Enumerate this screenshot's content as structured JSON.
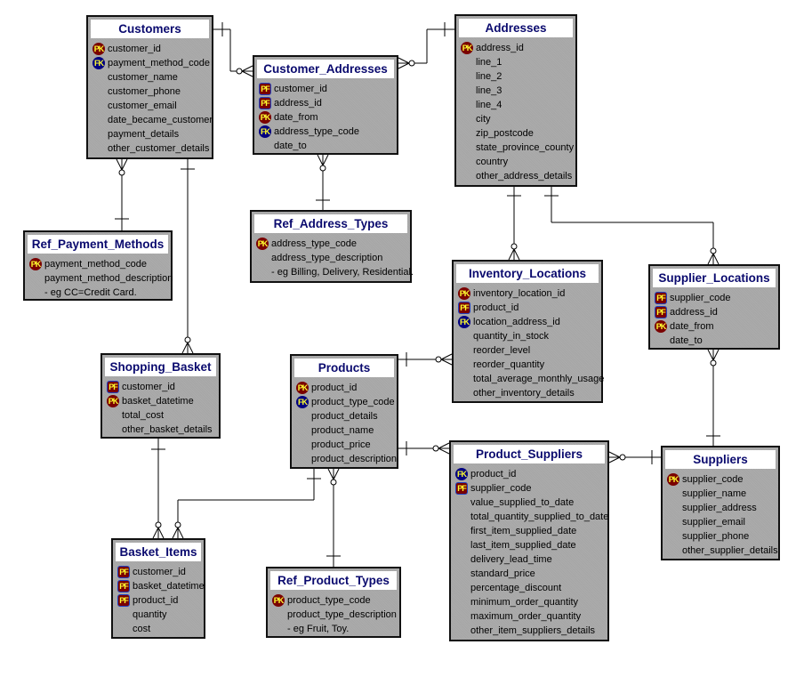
{
  "entities": {
    "customers": {
      "name": "Customers",
      "columns": [
        {
          "key": "PK",
          "name": "customer_id"
        },
        {
          "key": "FK",
          "name": "payment_method_code"
        },
        {
          "key": "",
          "name": "customer_name"
        },
        {
          "key": "",
          "name": "customer_phone"
        },
        {
          "key": "",
          "name": "customer_email"
        },
        {
          "key": "",
          "name": "date_became_customer"
        },
        {
          "key": "",
          "name": "payment_details"
        },
        {
          "key": "",
          "name": "other_customer_details"
        }
      ]
    },
    "customer_addresses": {
      "name": "Customer_Addresses",
      "columns": [
        {
          "key": "PF",
          "name": "customer_id"
        },
        {
          "key": "PF",
          "name": "address_id"
        },
        {
          "key": "PK",
          "name": "date_from"
        },
        {
          "key": "FK",
          "name": "address_type_code"
        },
        {
          "key": "",
          "name": "date_to"
        }
      ]
    },
    "addresses": {
      "name": "Addresses",
      "columns": [
        {
          "key": "PK",
          "name": "address_id"
        },
        {
          "key": "",
          "name": "line_1"
        },
        {
          "key": "",
          "name": "line_2"
        },
        {
          "key": "",
          "name": "line_3"
        },
        {
          "key": "",
          "name": "line_4"
        },
        {
          "key": "",
          "name": "city"
        },
        {
          "key": "",
          "name": "zip_postcode"
        },
        {
          "key": "",
          "name": "state_province_county"
        },
        {
          "key": "",
          "name": "country"
        },
        {
          "key": "",
          "name": "other_address_details"
        }
      ]
    },
    "ref_payment_methods": {
      "name": "Ref_Payment_Methods",
      "columns": [
        {
          "key": "PK",
          "name": "payment_method_code"
        },
        {
          "key": "",
          "name": "payment_method_description"
        },
        {
          "key": "",
          "name": "- eg CC=Credit Card."
        }
      ]
    },
    "ref_address_types": {
      "name": "Ref_Address_Types",
      "columns": [
        {
          "key": "PK",
          "name": "address_type_code"
        },
        {
          "key": "",
          "name": "address_type_description"
        },
        {
          "key": "",
          "name": "- eg Billing, Delivery, Residential."
        }
      ]
    },
    "inventory_locations": {
      "name": "Inventory_Locations",
      "columns": [
        {
          "key": "PK",
          "name": "inventory_location_id"
        },
        {
          "key": "PF",
          "name": "product_id"
        },
        {
          "key": "FK",
          "name": "location_address_id"
        },
        {
          "key": "",
          "name": "quantity_in_stock"
        },
        {
          "key": "",
          "name": "reorder_level"
        },
        {
          "key": "",
          "name": "reorder_quantity"
        },
        {
          "key": "",
          "name": "total_average_monthly_usage"
        },
        {
          "key": "",
          "name": "other_inventory_details"
        }
      ]
    },
    "supplier_locations": {
      "name": "Supplier_Locations",
      "columns": [
        {
          "key": "PF",
          "name": "supplier_code"
        },
        {
          "key": "PF",
          "name": "address_id"
        },
        {
          "key": "PK",
          "name": "date_from"
        },
        {
          "key": "",
          "name": "date_to"
        }
      ]
    },
    "shopping_basket": {
      "name": "Shopping_Basket",
      "columns": [
        {
          "key": "PF",
          "name": "customer_id"
        },
        {
          "key": "PK",
          "name": "basket_datetime"
        },
        {
          "key": "",
          "name": "total_cost"
        },
        {
          "key": "",
          "name": "other_basket_details"
        }
      ]
    },
    "products": {
      "name": "Products",
      "columns": [
        {
          "key": "PK",
          "name": "product_id"
        },
        {
          "key": "FK",
          "name": "product_type_code"
        },
        {
          "key": "",
          "name": "product_details"
        },
        {
          "key": "",
          "name": "product_name"
        },
        {
          "key": "",
          "name": "product_price"
        },
        {
          "key": "",
          "name": "product_description"
        }
      ]
    },
    "product_suppliers": {
      "name": "Product_Suppliers",
      "columns": [
        {
          "key": "FK",
          "name": "product_id"
        },
        {
          "key": "PF",
          "name": "supplier_code"
        },
        {
          "key": "",
          "name": "value_supplied_to_date"
        },
        {
          "key": "",
          "name": "total_quantity_supplied_to_date"
        },
        {
          "key": "",
          "name": "first_item_supplied_date"
        },
        {
          "key": "",
          "name": "last_item_supplied_date"
        },
        {
          "key": "",
          "name": "delivery_lead_time"
        },
        {
          "key": "",
          "name": "standard_price"
        },
        {
          "key": "",
          "name": "percentage_discount"
        },
        {
          "key": "",
          "name": "minimum_order_quantity"
        },
        {
          "key": "",
          "name": "maximum_order_quantity"
        },
        {
          "key": "",
          "name": "other_item_suppliers_details"
        }
      ]
    },
    "suppliers": {
      "name": "Suppliers",
      "columns": [
        {
          "key": "PK",
          "name": "supplier_code"
        },
        {
          "key": "",
          "name": "supplier_name"
        },
        {
          "key": "",
          "name": "supplier_address"
        },
        {
          "key": "",
          "name": "supplier_email"
        },
        {
          "key": "",
          "name": "supplier_phone"
        },
        {
          "key": "",
          "name": "other_supplier_details"
        }
      ]
    },
    "basket_items": {
      "name": "Basket_Items",
      "columns": [
        {
          "key": "PF",
          "name": "customer_id"
        },
        {
          "key": "PF",
          "name": "basket_datetime"
        },
        {
          "key": "PF",
          "name": "product_id"
        },
        {
          "key": "",
          "name": "quantity"
        },
        {
          "key": "",
          "name": "cost"
        }
      ]
    },
    "ref_product_types": {
      "name": "Ref_Product_Types",
      "columns": [
        {
          "key": "PK",
          "name": "product_type_code"
        },
        {
          "key": "",
          "name": "product_type_description"
        },
        {
          "key": "",
          "name": "- eg Fruit, Toy."
        }
      ]
    }
  },
  "relationships": [
    {
      "one": "customers",
      "many": "customer_addresses"
    },
    {
      "one": "addresses",
      "many": "customer_addresses"
    },
    {
      "one": "ref_payment_methods",
      "many": "customers"
    },
    {
      "one": "customers",
      "many": "shopping_basket"
    },
    {
      "one": "ref_address_types",
      "many": "customer_addresses"
    },
    {
      "one": "addresses",
      "many": "inventory_locations"
    },
    {
      "one": "addresses",
      "many": "supplier_locations"
    },
    {
      "one": "suppliers",
      "many": "supplier_locations"
    },
    {
      "one": "products",
      "many": "inventory_locations"
    },
    {
      "one": "products",
      "many": "product_suppliers"
    },
    {
      "one": "suppliers",
      "many": "product_suppliers"
    },
    {
      "one": "shopping_basket",
      "many": "basket_items"
    },
    {
      "one": "products",
      "many": "basket_items"
    },
    {
      "one": "ref_product_types",
      "many": "products"
    }
  ],
  "colors": {
    "entity_fill": "#a6a6a6",
    "title_text": "#0a0a6e",
    "pk_badge": "#7a0000",
    "fk_badge": "#000080",
    "badge_text": "#ffff30"
  }
}
